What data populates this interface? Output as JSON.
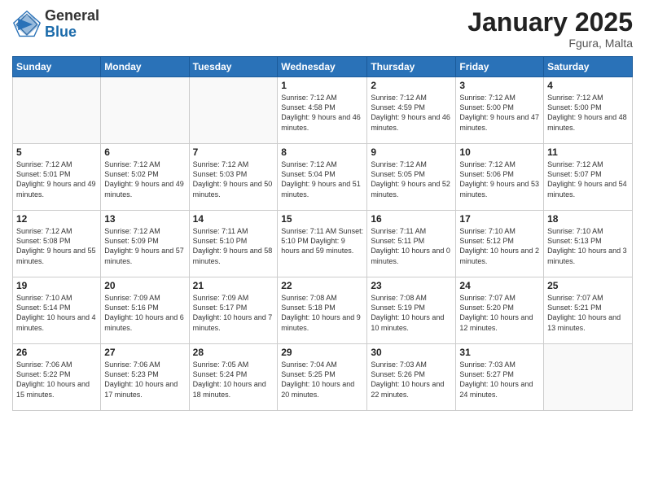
{
  "header": {
    "logo_general": "General",
    "logo_blue": "Blue",
    "month_title": "January 2025",
    "location": "Fgura, Malta"
  },
  "weekdays": [
    "Sunday",
    "Monday",
    "Tuesday",
    "Wednesday",
    "Thursday",
    "Friday",
    "Saturday"
  ],
  "weeks": [
    [
      {
        "day": "",
        "info": ""
      },
      {
        "day": "",
        "info": ""
      },
      {
        "day": "",
        "info": ""
      },
      {
        "day": "1",
        "info": "Sunrise: 7:12 AM\nSunset: 4:58 PM\nDaylight: 9 hours\nand 46 minutes."
      },
      {
        "day": "2",
        "info": "Sunrise: 7:12 AM\nSunset: 4:59 PM\nDaylight: 9 hours\nand 46 minutes."
      },
      {
        "day": "3",
        "info": "Sunrise: 7:12 AM\nSunset: 5:00 PM\nDaylight: 9 hours\nand 47 minutes."
      },
      {
        "day": "4",
        "info": "Sunrise: 7:12 AM\nSunset: 5:00 PM\nDaylight: 9 hours\nand 48 minutes."
      }
    ],
    [
      {
        "day": "5",
        "info": "Sunrise: 7:12 AM\nSunset: 5:01 PM\nDaylight: 9 hours\nand 49 minutes."
      },
      {
        "day": "6",
        "info": "Sunrise: 7:12 AM\nSunset: 5:02 PM\nDaylight: 9 hours\nand 49 minutes."
      },
      {
        "day": "7",
        "info": "Sunrise: 7:12 AM\nSunset: 5:03 PM\nDaylight: 9 hours\nand 50 minutes."
      },
      {
        "day": "8",
        "info": "Sunrise: 7:12 AM\nSunset: 5:04 PM\nDaylight: 9 hours\nand 51 minutes."
      },
      {
        "day": "9",
        "info": "Sunrise: 7:12 AM\nSunset: 5:05 PM\nDaylight: 9 hours\nand 52 minutes."
      },
      {
        "day": "10",
        "info": "Sunrise: 7:12 AM\nSunset: 5:06 PM\nDaylight: 9 hours\nand 53 minutes."
      },
      {
        "day": "11",
        "info": "Sunrise: 7:12 AM\nSunset: 5:07 PM\nDaylight: 9 hours\nand 54 minutes."
      }
    ],
    [
      {
        "day": "12",
        "info": "Sunrise: 7:12 AM\nSunset: 5:08 PM\nDaylight: 9 hours\nand 55 minutes."
      },
      {
        "day": "13",
        "info": "Sunrise: 7:12 AM\nSunset: 5:09 PM\nDaylight: 9 hours\nand 57 minutes."
      },
      {
        "day": "14",
        "info": "Sunrise: 7:11 AM\nSunset: 5:10 PM\nDaylight: 9 hours\nand 58 minutes."
      },
      {
        "day": "15",
        "info": "Sunrise: 7:11 AM\nSunset: 5:10 PM\nDaylight: 9 hours\nand 59 minutes."
      },
      {
        "day": "16",
        "info": "Sunrise: 7:11 AM\nSunset: 5:11 PM\nDaylight: 10 hours\nand 0 minutes."
      },
      {
        "day": "17",
        "info": "Sunrise: 7:10 AM\nSunset: 5:12 PM\nDaylight: 10 hours\nand 2 minutes."
      },
      {
        "day": "18",
        "info": "Sunrise: 7:10 AM\nSunset: 5:13 PM\nDaylight: 10 hours\nand 3 minutes."
      }
    ],
    [
      {
        "day": "19",
        "info": "Sunrise: 7:10 AM\nSunset: 5:14 PM\nDaylight: 10 hours\nand 4 minutes."
      },
      {
        "day": "20",
        "info": "Sunrise: 7:09 AM\nSunset: 5:16 PM\nDaylight: 10 hours\nand 6 minutes."
      },
      {
        "day": "21",
        "info": "Sunrise: 7:09 AM\nSunset: 5:17 PM\nDaylight: 10 hours\nand 7 minutes."
      },
      {
        "day": "22",
        "info": "Sunrise: 7:08 AM\nSunset: 5:18 PM\nDaylight: 10 hours\nand 9 minutes."
      },
      {
        "day": "23",
        "info": "Sunrise: 7:08 AM\nSunset: 5:19 PM\nDaylight: 10 hours\nand 10 minutes."
      },
      {
        "day": "24",
        "info": "Sunrise: 7:07 AM\nSunset: 5:20 PM\nDaylight: 10 hours\nand 12 minutes."
      },
      {
        "day": "25",
        "info": "Sunrise: 7:07 AM\nSunset: 5:21 PM\nDaylight: 10 hours\nand 13 minutes."
      }
    ],
    [
      {
        "day": "26",
        "info": "Sunrise: 7:06 AM\nSunset: 5:22 PM\nDaylight: 10 hours\nand 15 minutes."
      },
      {
        "day": "27",
        "info": "Sunrise: 7:06 AM\nSunset: 5:23 PM\nDaylight: 10 hours\nand 17 minutes."
      },
      {
        "day": "28",
        "info": "Sunrise: 7:05 AM\nSunset: 5:24 PM\nDaylight: 10 hours\nand 18 minutes."
      },
      {
        "day": "29",
        "info": "Sunrise: 7:04 AM\nSunset: 5:25 PM\nDaylight: 10 hours\nand 20 minutes."
      },
      {
        "day": "30",
        "info": "Sunrise: 7:03 AM\nSunset: 5:26 PM\nDaylight: 10 hours\nand 22 minutes."
      },
      {
        "day": "31",
        "info": "Sunrise: 7:03 AM\nSunset: 5:27 PM\nDaylight: 10 hours\nand 24 minutes."
      },
      {
        "day": "",
        "info": ""
      }
    ]
  ]
}
